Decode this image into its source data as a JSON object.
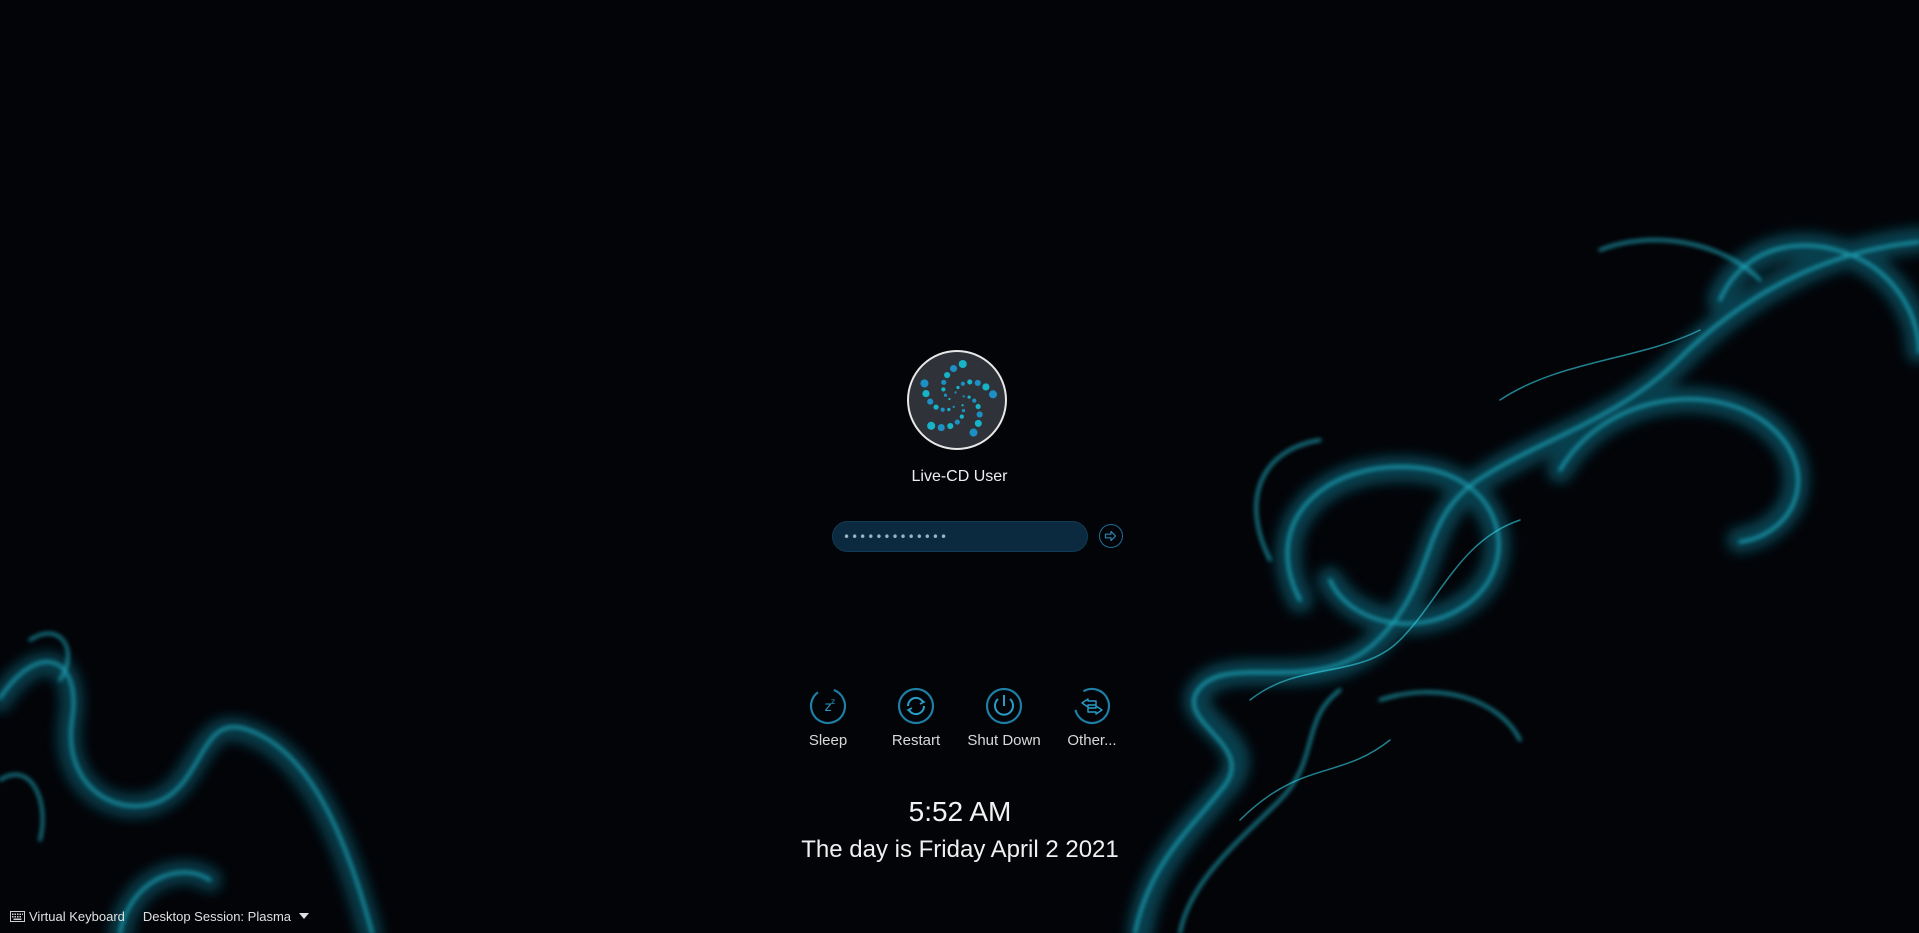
{
  "user": {
    "name": "Live-CD User"
  },
  "password": {
    "value": "•••••••••••••"
  },
  "actions": [
    {
      "label": "Sleep",
      "icon": "sleep-icon"
    },
    {
      "label": "Restart",
      "icon": "restart-icon"
    },
    {
      "label": "Shut Down",
      "icon": "shutdown-icon"
    },
    {
      "label": "Other...",
      "icon": "switch-user-icon"
    }
  ],
  "clock": {
    "time": "5:52 AM",
    "date": "The day is Friday April 2 2021"
  },
  "bottom_bar": {
    "virtual_keyboard": "Virtual Keyboard",
    "session": "Desktop Session: Plasma"
  },
  "colors": {
    "accent": "#1fb6c9",
    "background": "#030408",
    "smoke": "#1aa8c0"
  }
}
